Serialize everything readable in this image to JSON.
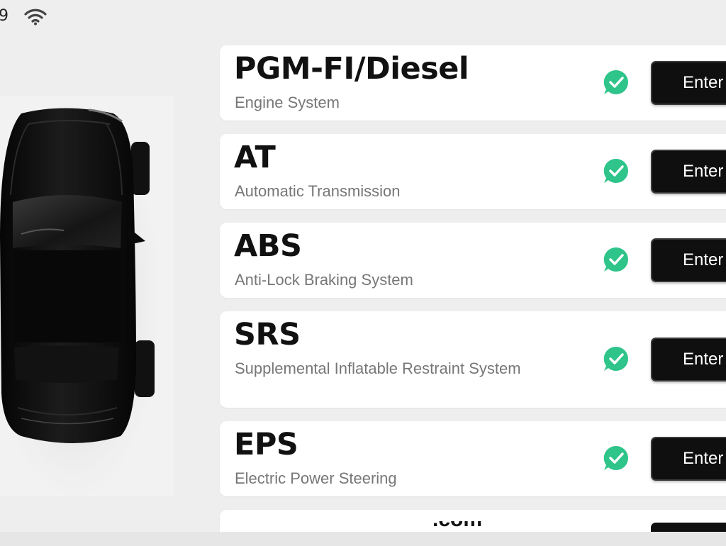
{
  "status": {
    "time": "9",
    "wifi_icon": "wifi-icon"
  },
  "colors": {
    "card_bg": "#ffffff",
    "check_green": "#2ec48a",
    "button_bg": "#0f0f0f",
    "page_bg": "#eeeeee"
  },
  "systems": [
    {
      "title": "PGM-FI/Diesel",
      "subtitle": "Engine System",
      "status_icon": "check-icon",
      "button": "Enter"
    },
    {
      "title": "AT",
      "subtitle": "Automatic Transmission",
      "status_icon": "check-icon",
      "button": "Enter"
    },
    {
      "title": "ABS",
      "subtitle": "Anti-Lock Braking System",
      "status_icon": "check-icon",
      "button": "Enter"
    },
    {
      "title": "SRS",
      "subtitle": "Supplemental Inflatable Restraint System",
      "status_icon": "check-icon",
      "button": "Enter"
    },
    {
      "title": "EPS",
      "subtitle": "Electric Power Steering",
      "status_icon": "check-icon",
      "button": "Enter"
    }
  ],
  "watermark": ".com"
}
